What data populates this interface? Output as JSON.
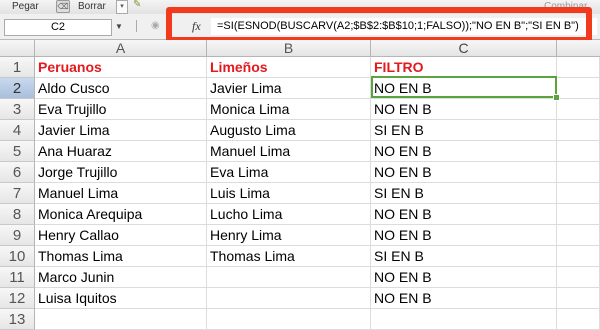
{
  "ribbon": {
    "paste_label": "Pegar",
    "erase_label": "Borrar",
    "combine_label": "Combinar"
  },
  "formula_bar": {
    "name_box": "C2",
    "fx_label": "fx",
    "formula": "=SI(ESNOD(BUSCARV(A2;$B$2:$B$10;1;FALSO));\"NO EN B\";\"SI EN B\")"
  },
  "columns": [
    "A",
    "B",
    "C"
  ],
  "row_numbers": [
    "1",
    "2",
    "3",
    "4",
    "5",
    "6",
    "7",
    "8",
    "9",
    "10",
    "11",
    "12",
    "13"
  ],
  "headers": {
    "a": "Peruanos",
    "b": "Limeños",
    "c": "FILTRO"
  },
  "rows": [
    {
      "a": "Aldo Cusco",
      "b": "Javier Lima",
      "c": "NO EN B"
    },
    {
      "a": "Eva Trujillo",
      "b": "Monica Lima",
      "c": "NO EN B"
    },
    {
      "a": "Javier Lima",
      "b": "Augusto Lima",
      "c": "SI EN B"
    },
    {
      "a": "Ana Huaraz",
      "b": "Manuel Lima",
      "c": "NO EN B"
    },
    {
      "a": "Jorge Trujillo",
      "b": "Eva Lima",
      "c": "NO EN B"
    },
    {
      "a": "Manuel Lima",
      "b": "Luis Lima",
      "c": "SI EN B"
    },
    {
      "a": "Monica Arequipa",
      "b": "Lucho Lima",
      "c": "NO EN B"
    },
    {
      "a": "Henry Callao",
      "b": "Henry Lima",
      "c": "NO EN B"
    },
    {
      "a": "Thomas Lima",
      "b": "Thomas Lima",
      "c": "SI EN B"
    },
    {
      "a": "Marco Junin",
      "b": "",
      "c": "NO EN B"
    },
    {
      "a": "Luisa Iquitos",
      "b": "",
      "c": "NO EN B"
    }
  ],
  "selected_cell": "C2",
  "colors": {
    "header_text": "#e3191d",
    "highlight_box": "#f23a1e",
    "selection": "#5aa33f"
  }
}
